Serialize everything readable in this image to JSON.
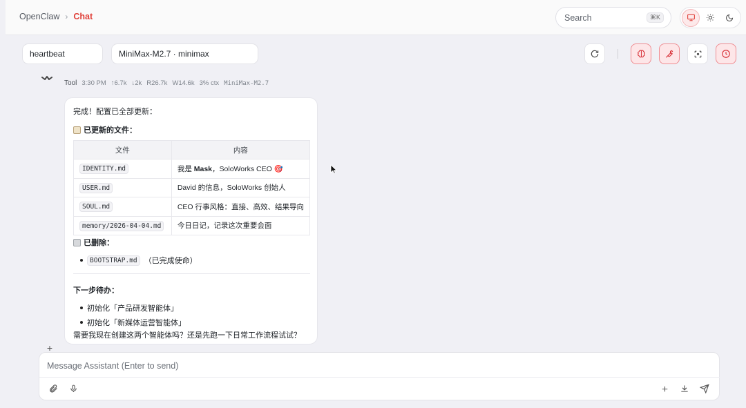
{
  "breadcrumb": {
    "root": "OpenClaw",
    "separator": "›",
    "current": "Chat"
  },
  "search": {
    "placeholder": "Search",
    "shortcut": "⌘K"
  },
  "theme": {
    "active": "monitor"
  },
  "toolbar": {
    "agent": "heartbeat",
    "model": "MiniMax-M2.7 · minimax",
    "buttons": [
      "refresh-icon",
      "brain-icon",
      "wrench-icon",
      "focus-icon",
      "clock-icon"
    ]
  },
  "message": {
    "author": "Tool",
    "time": "3:30 PM",
    "tokens_up": "↑6.7k",
    "tokens_down": "↓2k",
    "reads": "R26.7k",
    "writes": "W14.6k",
    "ctx": "3% ctx",
    "model": "MiniMax-M2.7",
    "intro": "完成！配置已全部更新：",
    "updated_heading": "已更新的文件：",
    "table": {
      "headers": [
        "文件",
        "内容"
      ],
      "rows": [
        {
          "file": "IDENTITY.md",
          "content_pre": "我是 ",
          "content_bold": "Mask",
          "content_post": "，SoloWorks CEO 🎯"
        },
        {
          "file": "USER.md",
          "content_pre": "David 的信息，SoloWorks 创始人",
          "content_bold": "",
          "content_post": ""
        },
        {
          "file": "SOUL.md",
          "content_pre": "CEO 行事风格：直接、高效、结果导向",
          "content_bold": "",
          "content_post": ""
        },
        {
          "file": "memory/2026-04-04.md",
          "content_pre": "今日日记，记录这次重要会面",
          "content_bold": "",
          "content_post": ""
        }
      ]
    },
    "deleted_heading": "已删除：",
    "deleted_file": "BOOTSTRAP.md",
    "deleted_note": "（已完成使命）",
    "next_heading": "下一步待办：",
    "next_items": [
      "初始化「产品研发智能体」",
      "初始化「新媒体运营智能体」"
    ],
    "question": "需要我现在创建这两个智能体吗？还是先跑一下日常工作流程试试？"
  },
  "composer": {
    "placeholder": "Message Assistant (Enter to send)"
  },
  "colors": {
    "accent": "#e0413a",
    "accent_bg": "#fde6e8",
    "page_bg": "#f0f0f5"
  }
}
